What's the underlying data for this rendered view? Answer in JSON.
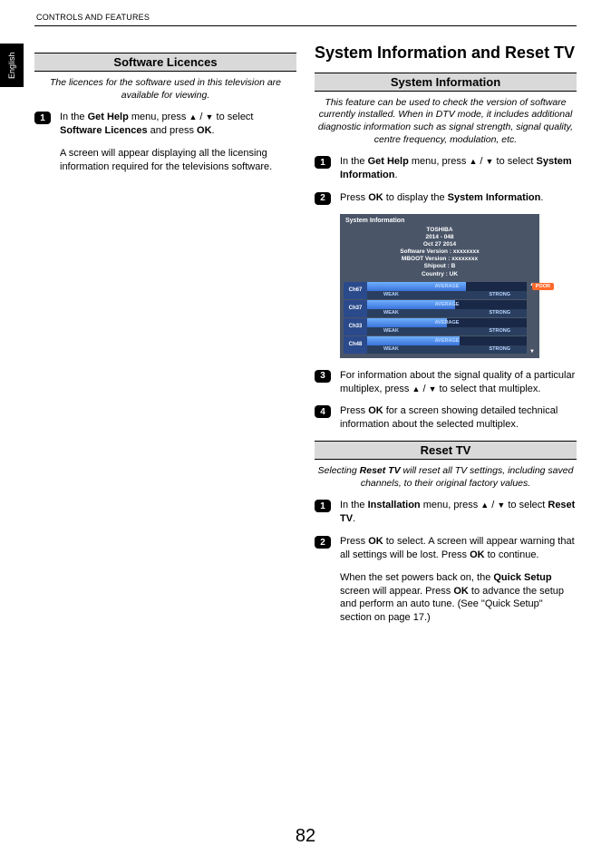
{
  "header": "CONTROLS AND FEATURES",
  "language_tab": "English",
  "page_number": "82",
  "left_column": {
    "section1": {
      "heading": "Software Licences",
      "intro": "The licences for the software used in this television are available for viewing.",
      "steps": [
        {
          "num": "1",
          "parts": [
            "In the ",
            "Get Help",
            " menu, press ",
            "▲",
            " / ",
            "▼",
            " to select ",
            "Software Licences",
            " and press ",
            "OK",
            "."
          ]
        }
      ],
      "post_text": "A screen will appear displaying all the licensing information required for the televisions software."
    }
  },
  "right_column": {
    "main_title": "System Information and Reset TV",
    "section1": {
      "heading": "System Information",
      "intro": "This feature can be used to check the version of software currently installed. When in DTV mode, it includes additional diagnostic information such as signal strength, signal quality, centre frequency, modulation, etc.",
      "steps": [
        {
          "num": "1",
          "parts": [
            "In the ",
            "Get Help",
            " menu, press ",
            "▲",
            " / ",
            "▼",
            " to select ",
            "System Information",
            "."
          ]
        },
        {
          "num": "2",
          "parts": [
            "Press ",
            "OK",
            " to display the ",
            "System Information",
            "."
          ]
        },
        {
          "num": "3",
          "parts": [
            "For information about the signal quality of a particular multiplex, press ",
            "▲",
            " / ",
            "▼",
            " to select that multiplex."
          ]
        },
        {
          "num": "4",
          "parts": [
            "Press ",
            "OK",
            " for a screen showing detailed technical information about the selected multiplex."
          ]
        }
      ]
    },
    "sysinfo_box": {
      "title": "System Information",
      "brand": "TOSHIBA",
      "model": "2014 - 048",
      "date": "Oct 27 2014",
      "sw_line": "Software Version : xxxxxxxx",
      "mboot_line": "MBOOT Version : xxxxxxxx",
      "shipout_line": "Shipout : B",
      "country_line": "Country : UK",
      "poor_label": "POOR",
      "avg_label": "AVERAGE",
      "weak_label": "WEAK",
      "strong_label": "STRONG",
      "channels": [
        {
          "ch": "Ch67",
          "fill": 62,
          "poor": true
        },
        {
          "ch": "Ch37",
          "fill": 55,
          "poor": false
        },
        {
          "ch": "Ch33",
          "fill": 50,
          "poor": false
        },
        {
          "ch": "Ch48",
          "fill": 58,
          "poor": false
        }
      ]
    },
    "section2": {
      "heading": "Reset TV",
      "intro_parts": [
        "Selecting ",
        "Reset TV",
        " will reset all TV settings, including saved channels, to their original factory values."
      ],
      "steps": [
        {
          "num": "1",
          "parts": [
            "In the ",
            "Installation",
            " menu, press ",
            "▲",
            " / ",
            "▼",
            " to select ",
            "Reset TV",
            "."
          ]
        },
        {
          "num": "2",
          "parts": [
            "Press ",
            "OK",
            " to select. A screen will appear warning that all settings will be lost. Press ",
            "OK",
            " to continue."
          ]
        }
      ],
      "post_parts": [
        "When the set powers back on, the ",
        "Quick Setup",
        " screen will appear. Press ",
        "OK",
        " to advance the setup and perform an auto tune. (See \"Quick Setup\" section on page 17.)"
      ]
    }
  }
}
